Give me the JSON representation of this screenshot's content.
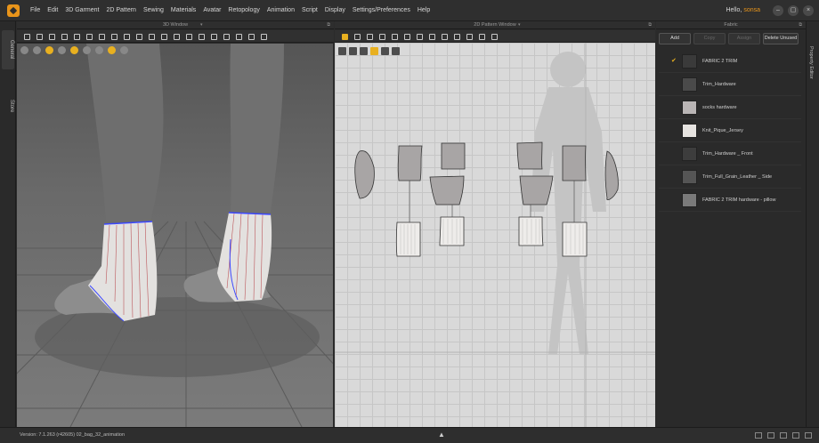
{
  "menubar": {
    "items": [
      "File",
      "Edit",
      "3D Garment",
      "2D Pattern",
      "Sewing",
      "Materials",
      "Avatar",
      "Retopology",
      "Animation",
      "Script",
      "Display",
      "Settings/Preferences",
      "Help"
    ],
    "greeting": "Hello,",
    "username": "sonsa"
  },
  "left_tabs": {
    "general": "General",
    "store": "Store"
  },
  "panels": {
    "view3d_title": "3D Window",
    "view2d_title": "2D Pattern Window",
    "fabric_title": "Fabric"
  },
  "fabric": {
    "buttons": {
      "add": "Add",
      "copy": "Copy",
      "assign": "Assign",
      "delete_unused": "Delete Unused"
    },
    "items": [
      {
        "name": "FABRIC 2 TRIM",
        "color": "#3a3a3a",
        "checked": true
      },
      {
        "name": "Trim_Hardware",
        "color": "#4a4a4a",
        "checked": false
      },
      {
        "name": "socks hardware",
        "color": "#b9b5b5",
        "checked": false
      },
      {
        "name": "Knit_Pique_Jersey",
        "color": "#e6e3e0",
        "checked": false
      },
      {
        "name": "Trim_Hardware _ Front",
        "color": "#3d3d3d",
        "checked": false
      },
      {
        "name": "Trim_Full_Grain_Leather _ Side",
        "color": "#555555",
        "checked": false
      },
      {
        "name": "FABRIC 2 TRIM hardware - pillow",
        "color": "#7a7a7a",
        "checked": false
      }
    ]
  },
  "right_tab": "Property Editor",
  "status": {
    "version": "Version:   7.1.263 (r42605)   02_bag_32_animation"
  },
  "colors": {
    "accent": "#e8941a",
    "stitch": "#3b47ff",
    "seam": "#b2343a"
  }
}
